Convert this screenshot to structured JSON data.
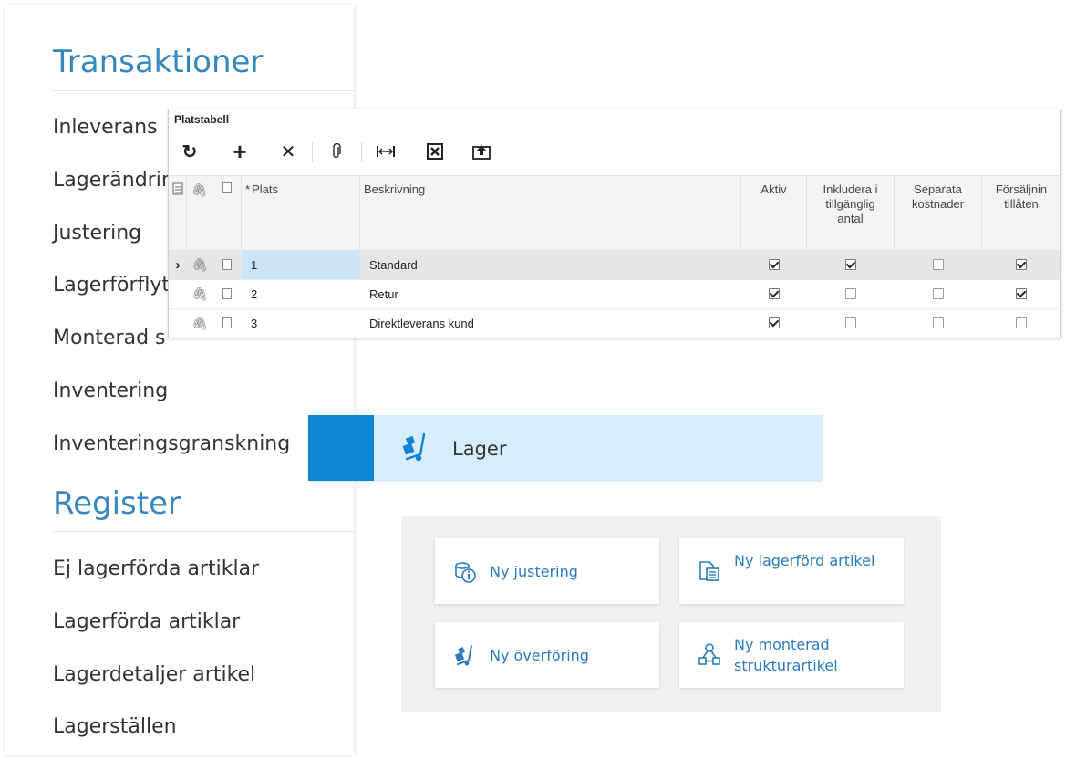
{
  "menu": {
    "transactions_heading": "Transaktioner",
    "transactions": [
      "Inleverans",
      "Lagerändrin",
      "Justering",
      "Lagerförflyt",
      "Monterad s",
      "Inventering",
      "Inventeringsgranskning"
    ],
    "register_heading": "Register",
    "register": [
      "Ej lagerförda artiklar",
      "Lagerförda artiklar",
      "Lagerdetaljer artikel",
      "Lagerställen"
    ]
  },
  "grid": {
    "title": "Platstabell",
    "toolbar": [
      {
        "icon": "refresh-icon",
        "glyph": "↻"
      },
      {
        "icon": "add-icon",
        "glyph": "+"
      },
      {
        "icon": "delete-icon",
        "glyph": "✕"
      },
      {
        "icon": "attach-icon",
        "glyph": "📎"
      },
      {
        "icon": "fit-columns-icon",
        "glyph": "⟷"
      },
      {
        "icon": "export-excel-icon",
        "glyph": "⊠"
      },
      {
        "icon": "upload-icon",
        "glyph": "⇪"
      }
    ],
    "columns": {
      "required_marker": "*",
      "plats": "Plats",
      "beskrivning": "Beskrivning",
      "aktiv": "Aktiv",
      "inkludera": "Inkludera i tillgänglig antal",
      "separata": "Separata kostnader",
      "forsaljning": "Försäljnin tillåten"
    },
    "rows": [
      {
        "plats": "1",
        "beskrivning": "Standard",
        "aktiv": true,
        "inkludera": true,
        "separata": false,
        "forsaljning": true,
        "selected": true
      },
      {
        "plats": "2",
        "beskrivning": "Retur",
        "aktiv": true,
        "inkludera": false,
        "separata": false,
        "forsaljning": true,
        "selected": false
      },
      {
        "plats": "3",
        "beskrivning": "Direktleverans kund",
        "aktiv": true,
        "inkludera": false,
        "separata": false,
        "forsaljning": false,
        "selected": false
      }
    ]
  },
  "banner": {
    "label": "Lager",
    "icon": "hand-truck-icon",
    "accent": "#0d84d4",
    "background": "#d8edfb"
  },
  "quick_actions": [
    {
      "label": "Ny justering",
      "icon": "coins-info-icon"
    },
    {
      "label": "Ny lagerförd artikel",
      "icon": "document-list-icon"
    },
    {
      "label": "Ny överföring",
      "icon": "hand-truck-icon"
    },
    {
      "label": "Ny monterad strukturartikel",
      "icon": "hierarchy-icon"
    }
  ]
}
